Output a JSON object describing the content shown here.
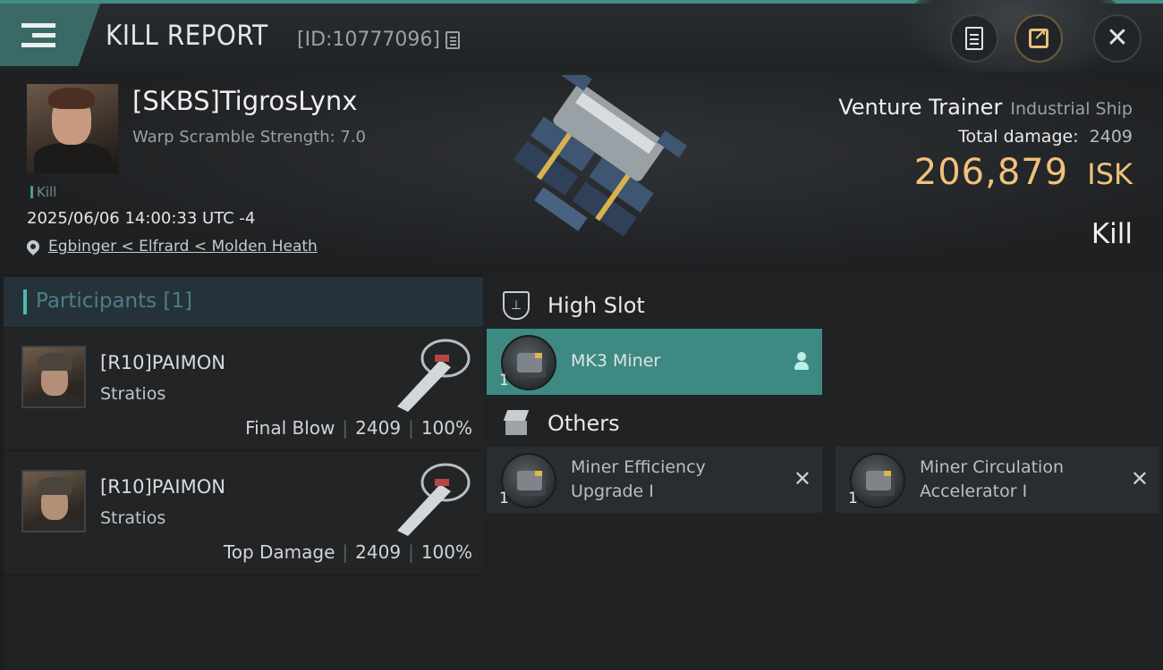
{
  "header": {
    "title": "KILL REPORT",
    "report_id": "[ID:10777096]",
    "icons": {
      "menu": "hamburger-menu-icon",
      "copy": "copy-icon",
      "clipboard": "clipboard-icon",
      "share": "share-icon",
      "close": "close-icon"
    }
  },
  "victim": {
    "name": "[SKBS]TigrosLynx",
    "warp_scramble": "Warp Scramble Strength: 7.0",
    "tag": "Kill",
    "datetime": "2025/06/06 14:00:33 UTC -4",
    "location": "Egbinger < Elfrard < Molden Heath",
    "ship_name": "Venture Trainer",
    "ship_class": "Industrial Ship",
    "total_damage_label": "Total damage:",
    "total_damage": "2409",
    "isk_value": "206,879",
    "isk_unit": "ISK",
    "result": "Kill"
  },
  "participants": {
    "header": "Participants [1]",
    "list": [
      {
        "name": "[R10]PAIMON",
        "ship": "Stratios",
        "role": "Final Blow",
        "damage": "2409",
        "percent": "100%"
      },
      {
        "name": "[R10]PAIMON",
        "ship": "Stratios",
        "role": "Top Damage",
        "damage": "2409",
        "percent": "100%"
      }
    ]
  },
  "slots": {
    "high": {
      "title": "High Slot",
      "items": [
        {
          "name": "MK3 Miner",
          "qty": "1"
        }
      ]
    },
    "others": {
      "title": "Others",
      "items": [
        {
          "name": "Miner Efficiency Upgrade I",
          "qty": "1"
        },
        {
          "name": "Miner Circulation Accelerator I",
          "qty": "1"
        }
      ]
    }
  },
  "colors": {
    "accent_teal": "#3d8a83",
    "isk_gold": "#f0c27a",
    "participants_header_text": "#4e7d88"
  }
}
